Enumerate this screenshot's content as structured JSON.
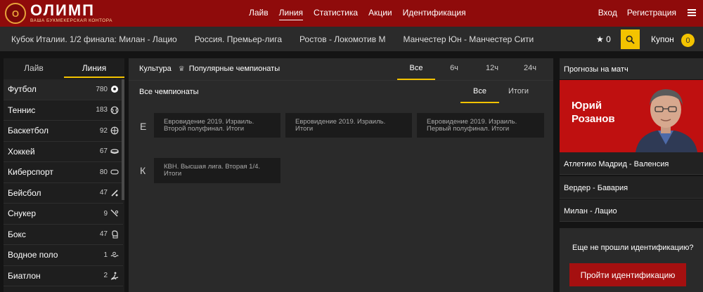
{
  "brand": {
    "logo_mark": "О",
    "name": "ОЛИМП",
    "tagline": "ВАША БУКМЕКЕРСКАЯ КОНТОРА"
  },
  "nav": [
    {
      "label": "Лайв"
    },
    {
      "label": "Линия",
      "active": true
    },
    {
      "label": "Статистика"
    },
    {
      "label": "Акции"
    },
    {
      "label": "Идентификация"
    }
  ],
  "auth": {
    "login": "Вход",
    "register": "Регистрация"
  },
  "top_events": [
    "Кубок Италии. 1/2 финала: Милан - Лацио",
    "Россия. Премьер-лига",
    "Ростов - Локомотив М",
    "Манчестер Юн - Манчестер Сити"
  ],
  "favorites": {
    "icon": "star-icon",
    "count": "0"
  },
  "coupon": {
    "label": "Купон",
    "count": "0"
  },
  "sidebar": {
    "tabs": [
      "Лайв",
      "Линия"
    ],
    "active_tab": "Линия",
    "sports": [
      {
        "label": "Футбол",
        "count": "780",
        "icon": "football-icon"
      },
      {
        "label": "Теннис",
        "count": "183",
        "icon": "tennis-icon"
      },
      {
        "label": "Баскетбол",
        "count": "92",
        "icon": "basketball-icon"
      },
      {
        "label": "Хоккей",
        "count": "67",
        "icon": "hockey-icon"
      },
      {
        "label": "Киберспорт",
        "count": "80",
        "icon": "gamepad-icon"
      },
      {
        "label": "Бейсбол",
        "count": "47",
        "icon": "baseball-icon"
      },
      {
        "label": "Снукер",
        "count": "9",
        "icon": "snooker-icon"
      },
      {
        "label": "Бокс",
        "count": "47",
        "icon": "boxing-icon"
      },
      {
        "label": "Водное поло",
        "count": "1",
        "icon": "waterpolo-icon"
      },
      {
        "label": "Биатлон",
        "count": "2",
        "icon": "biathlon-icon"
      }
    ]
  },
  "main": {
    "category": "Культура",
    "section": "Популярные чемпионаты",
    "period_tabs": [
      "Все",
      "6ч",
      "12ч",
      "24ч"
    ],
    "active_period": "Все",
    "all_champs": "Все чемпионаты",
    "view_tabs": [
      "Все",
      "Итоги"
    ],
    "active_view": "Все",
    "groups": [
      {
        "letter": "Е",
        "items": [
          {
            "line1": "Евровидение 2019. Израиль.",
            "line2": "Второй полуфинал. Итоги"
          },
          {
            "line1": "Евровидение 2019. Израиль.",
            "line2": "Итоги"
          },
          {
            "line1": "Евровидение 2019. Израиль.",
            "line2": "Первый полуфинал. Итоги"
          }
        ]
      },
      {
        "letter": "К",
        "items": [
          {
            "line1": "КВН. Высшая лига. Вторая 1/4.",
            "line2": "Итоги"
          }
        ]
      }
    ]
  },
  "right": {
    "title": "Прогнозы на матч",
    "expert": {
      "first": "Юрий",
      "last": "Розанов"
    },
    "matches": [
      "Атлетико Мадрид - Валенсия",
      "Вердер - Бавария",
      "Милан - Лацио"
    ],
    "ident_question": "Еще не прошли идентификацию?",
    "ident_button": "Пройти идентификацию"
  },
  "colors": {
    "brand_red": "#8f0b0b",
    "accent_yellow": "#f3c300",
    "banner_red": "#bf1010"
  }
}
